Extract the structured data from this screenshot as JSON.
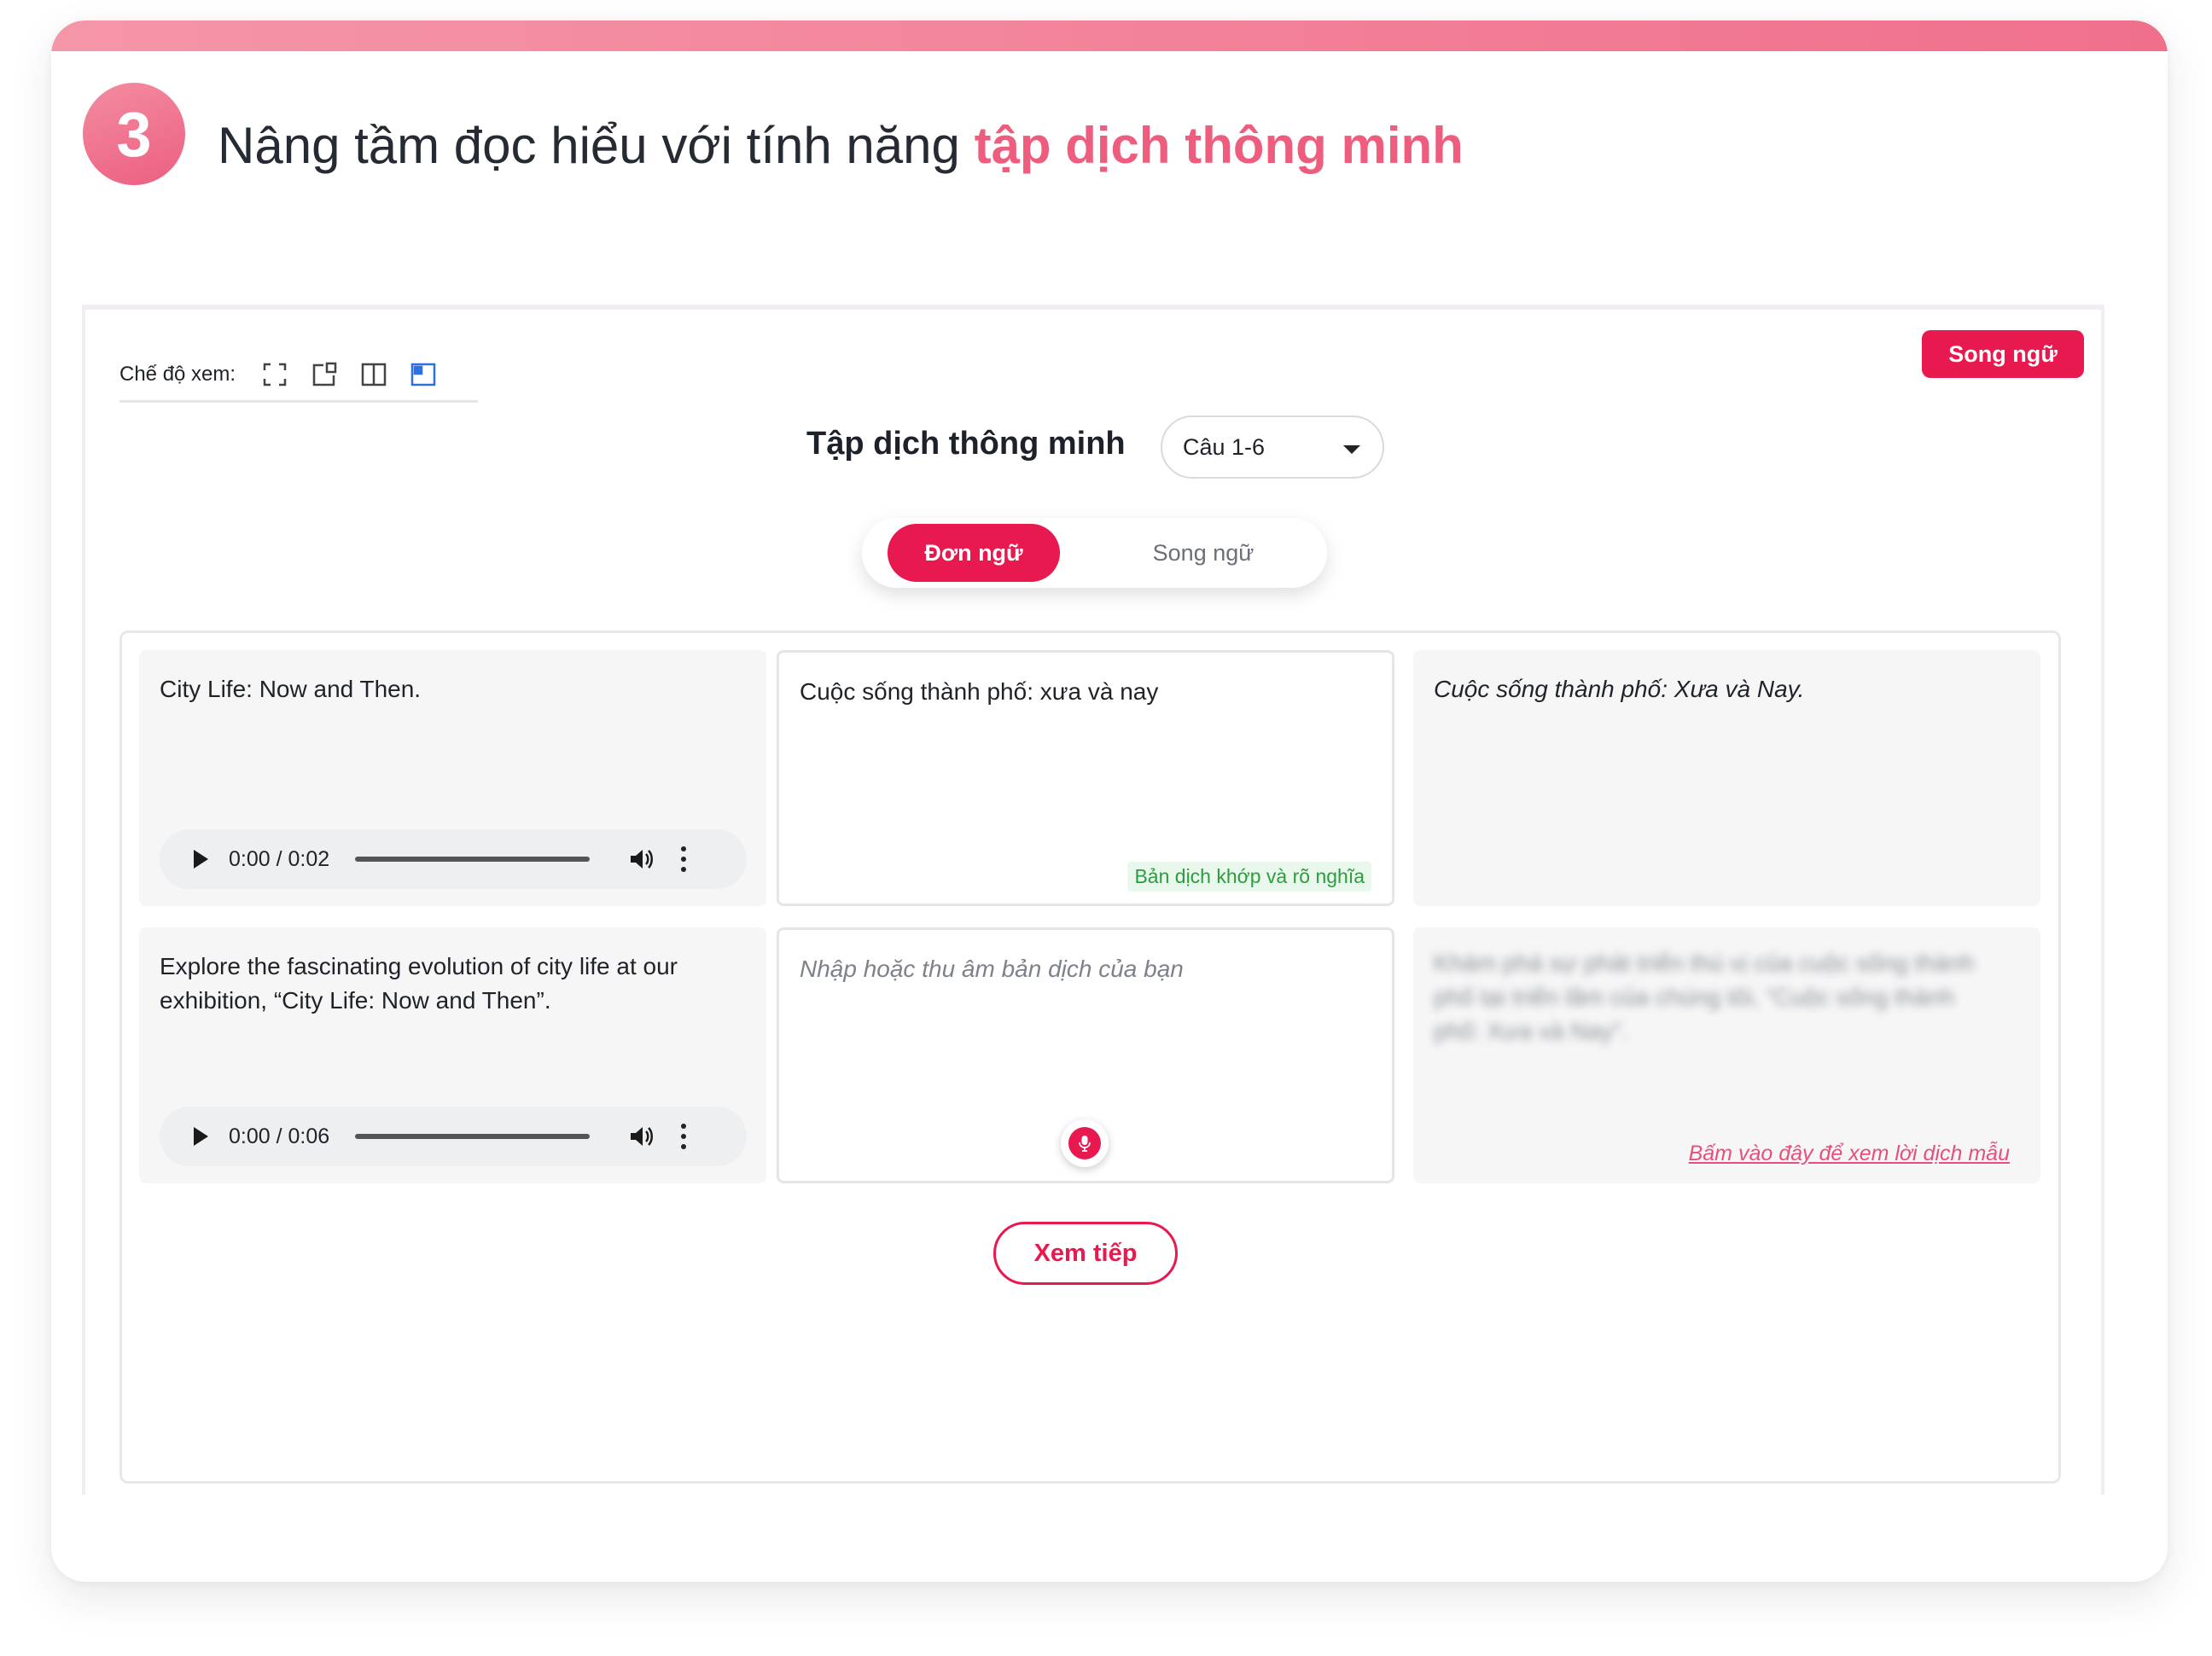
{
  "header": {
    "step_number": "3",
    "headline_prefix": "Nâng tầm đọc hiểu với tính năng ",
    "headline_highlight": "tập dịch thông minh"
  },
  "toolbar": {
    "view_mode_label": "Chế độ xem:",
    "view_icons": [
      "fullscreen-icon",
      "popout-icon",
      "split-columns-icon",
      "sidebar-layout-icon"
    ],
    "active_view_icon": "sidebar-layout-icon",
    "language_pill": "Song ngữ"
  },
  "main": {
    "title": "Tập dịch thông minh",
    "question_select": "Câu 1-6",
    "mode_toggle": {
      "active": "Đơn ngữ",
      "inactive": "Song ngữ"
    },
    "rows": [
      {
        "source": "City Life: Now and Then.",
        "audio_time": "0:00 / 0:02",
        "user_translation": "Cuộc sống thành phố: xưa và nay",
        "feedback": "Bản dịch khớp và rõ nghĩa",
        "sample_translation": "Cuộc sống thành phố: Xưa và Nay."
      },
      {
        "source": "Explore the fascinating evolution of city life at our exhibition, “City Life: Now and Then”.",
        "audio_time": "0:00 / 0:06",
        "input_placeholder": "Nhập hoặc thu âm bản dịch của bạn",
        "sample_translation_hidden": "Khám phá sự phát triển thú vị của cuộc sống thành phố tại triển lãm của chúng tôi, “Cuộc sống thành phố: Xưa và Nay”.",
        "sample_link": "Bấm vào đây để xem lời dịch mẫu"
      }
    ],
    "next_button": "Xem tiếp"
  },
  "colors": {
    "accent": "#e8194f",
    "headline_accent": "#ee5d7e",
    "feedback_green": "#2a9d3c",
    "active_view_icon": "#2f6fe0"
  }
}
